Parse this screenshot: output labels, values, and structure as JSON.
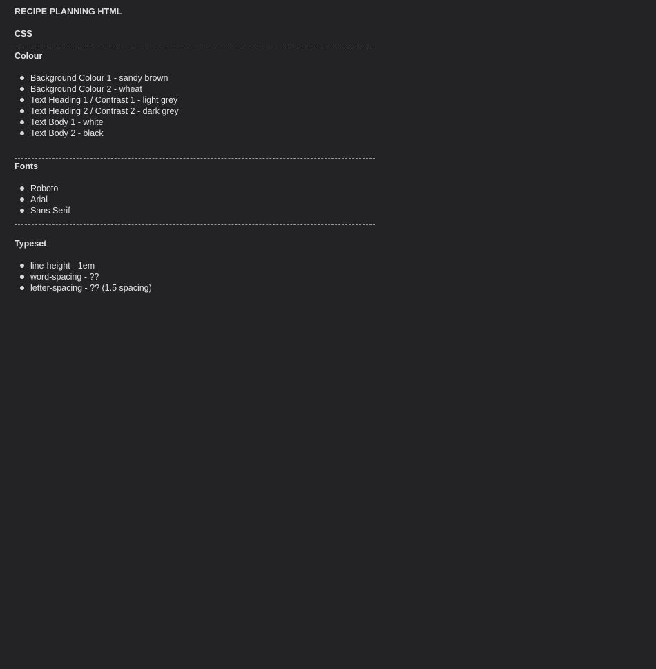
{
  "note": {
    "title": "RECIPE PLANNING HTML",
    "subtitle": "CSS",
    "sections": [
      {
        "heading": "Colour",
        "items": [
          "Background Colour 1 - sandy brown",
          "Background Colour 2 - wheat",
          "Text Heading 1 / Contrast 1 - light grey",
          "Text Heading 2 / Contrast 2 - dark grey",
          "Text Body 1 - white",
          "Text Body 2 - black"
        ]
      },
      {
        "heading": "Fonts",
        "items": [
          "Roboto",
          "Arial",
          "Sans Serif"
        ]
      },
      {
        "heading": "Typeset",
        "items": [
          "line-height - 1em",
          "word-spacing - ??",
          "letter-spacing - ?? (1.5 spacing)"
        ]
      }
    ]
  },
  "colors": {
    "background": "#232325",
    "text": "#e6e6e6",
    "divider": "#9a9a9a"
  }
}
